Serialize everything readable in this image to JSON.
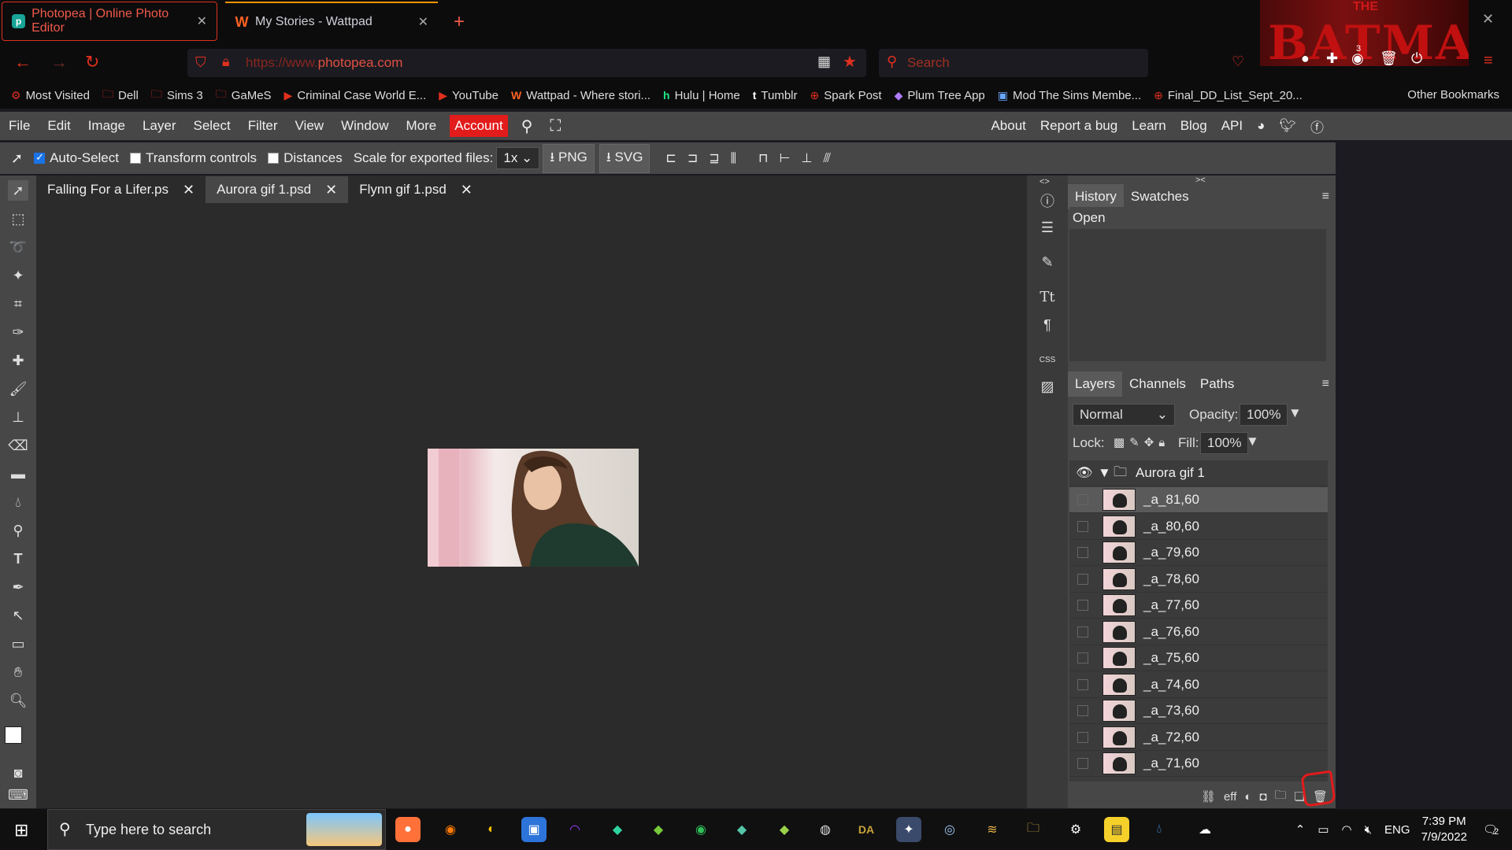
{
  "browser": {
    "tabs": [
      {
        "title": "Photopea | Online Photo Editor",
        "active": true
      },
      {
        "title": "My Stories - Wattpad",
        "active": false
      }
    ],
    "url_prefix": "https://www.",
    "url_domain": "photopea.com",
    "search_placeholder": "Search",
    "extension_badge": "3",
    "theme_text": "THE BATMAN",
    "bookmarks": [
      {
        "label": "Most Visited",
        "icon": "gear-icon"
      },
      {
        "label": "Dell",
        "icon": "folder-icon"
      },
      {
        "label": "Sims 3",
        "icon": "folder-icon"
      },
      {
        "label": "GaMeS",
        "icon": "folder-icon"
      },
      {
        "label": "Criminal Case World E...",
        "icon": "youtube-icon"
      },
      {
        "label": "YouTube",
        "icon": "youtube-icon"
      },
      {
        "label": "Wattpad - Where stori...",
        "icon": "wattpad-icon"
      },
      {
        "label": "Hulu | Home",
        "icon": "hulu-icon"
      },
      {
        "label": "Tumblr",
        "icon": "tumblr-icon"
      },
      {
        "label": "Spark Post",
        "icon": "globe-icon"
      },
      {
        "label": "Plum Tree App",
        "icon": "plum-icon"
      },
      {
        "label": "Mod The Sims Membe...",
        "icon": "image-icon"
      },
      {
        "label": "Final_DD_List_Sept_20...",
        "icon": "globe-icon"
      }
    ],
    "other_bookmarks": "Other Bookmarks"
  },
  "menubar": {
    "items": [
      "File",
      "Edit",
      "Image",
      "Layer",
      "Select",
      "Filter",
      "View",
      "Window",
      "More"
    ],
    "account": "Account",
    "right": [
      "About",
      "Report a bug",
      "Learn",
      "Blog",
      "API"
    ]
  },
  "options": {
    "auto_select": "Auto-Select",
    "transform_controls": "Transform controls",
    "distances": "Distances",
    "scale_label": "Scale for exported files:",
    "scale_value": "1x",
    "png": "PNG",
    "svg": "SVG"
  },
  "documents": [
    {
      "name": "Falling For a Lifer.ps",
      "active": false
    },
    {
      "name": "Aurora gif 1.psd",
      "active": true
    },
    {
      "name": "Flynn gif 1.psd",
      "active": false
    }
  ],
  "history": {
    "tabs": [
      "History",
      "Swatches"
    ],
    "items": [
      "Open"
    ]
  },
  "layers": {
    "tabs": [
      "Layers",
      "Channels",
      "Paths"
    ],
    "blend_mode": "Normal",
    "opacity_label": "Opacity:",
    "opacity": "100%",
    "lock_label": "Lock:",
    "fill_label": "Fill:",
    "fill": "100%",
    "group": "Aurora gif 1",
    "rows": [
      "_a_81,60",
      "_a_80,60",
      "_a_79,60",
      "_a_78,60",
      "_a_77,60",
      "_a_76,60",
      "_a_75,60",
      "_a_74,60",
      "_a_73,60",
      "_a_72,60",
      "_a_71,60"
    ]
  },
  "taskbar": {
    "search_placeholder": "Type here to search",
    "language": "ENG",
    "time": "7:39 PM",
    "date": "7/9/2022",
    "notification_count": "2"
  },
  "colors": {
    "accent_red": "#e21b1b",
    "panel_gray": "#474747",
    "canvas_bg": "#2b2b2b"
  }
}
